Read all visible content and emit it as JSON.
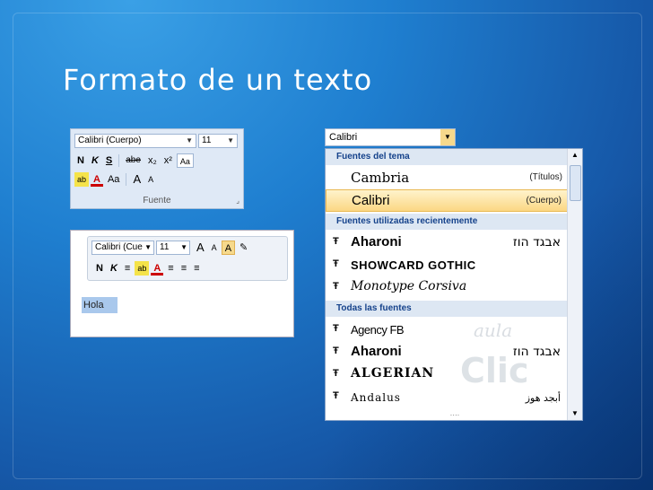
{
  "slide": {
    "title": "Formato de un texto"
  },
  "ribbon": {
    "font_name": "Calibri (Cuerpo)",
    "font_size": "11",
    "row1": [
      "N",
      "K",
      "S",
      "abe",
      "x₂",
      "x²",
      "Aa"
    ],
    "row2": [
      "ab",
      "A",
      "Aa",
      "A",
      "A"
    ],
    "group_label": "Fuente"
  },
  "mini_toolbar": {
    "font_name": "Calibri (Cue",
    "font_size": "11",
    "row1": [
      "A",
      "A",
      "A",
      "✎"
    ],
    "row2": [
      "N",
      "K",
      "≡",
      "ab",
      "A",
      "≡",
      "≡",
      "≡"
    ]
  },
  "document": {
    "text": "Hola"
  },
  "font_dropdown": {
    "selected": "Calibri",
    "header_theme": "Fuentes del tema",
    "theme_items": [
      {
        "name": "Cambria",
        "tag": "(Títulos)"
      },
      {
        "name": "Calibri",
        "tag": "(Cuerpo)"
      }
    ],
    "header_recent": "Fuentes utilizadas recientemente",
    "recent_items": [
      {
        "name": "Aharoni",
        "sample": "אבגד הוז"
      },
      {
        "name": "SHOWCARD GOTHIC",
        "sample": ""
      },
      {
        "name": "Monotype Corsiva",
        "sample": ""
      }
    ],
    "header_all": "Todas las fuentes",
    "all_items": [
      {
        "name": "Agency FB",
        "sample": ""
      },
      {
        "name": "Aharoni",
        "sample": "אבגד הוז"
      },
      {
        "name": "ALGERIAN",
        "sample": ""
      },
      {
        "name": "Andalus",
        "sample": "أبجد هوز"
      }
    ],
    "font_icon": "Ŧ",
    "watermark_top": "aula",
    "watermark_bottom": "Clic",
    "grip": "····"
  }
}
